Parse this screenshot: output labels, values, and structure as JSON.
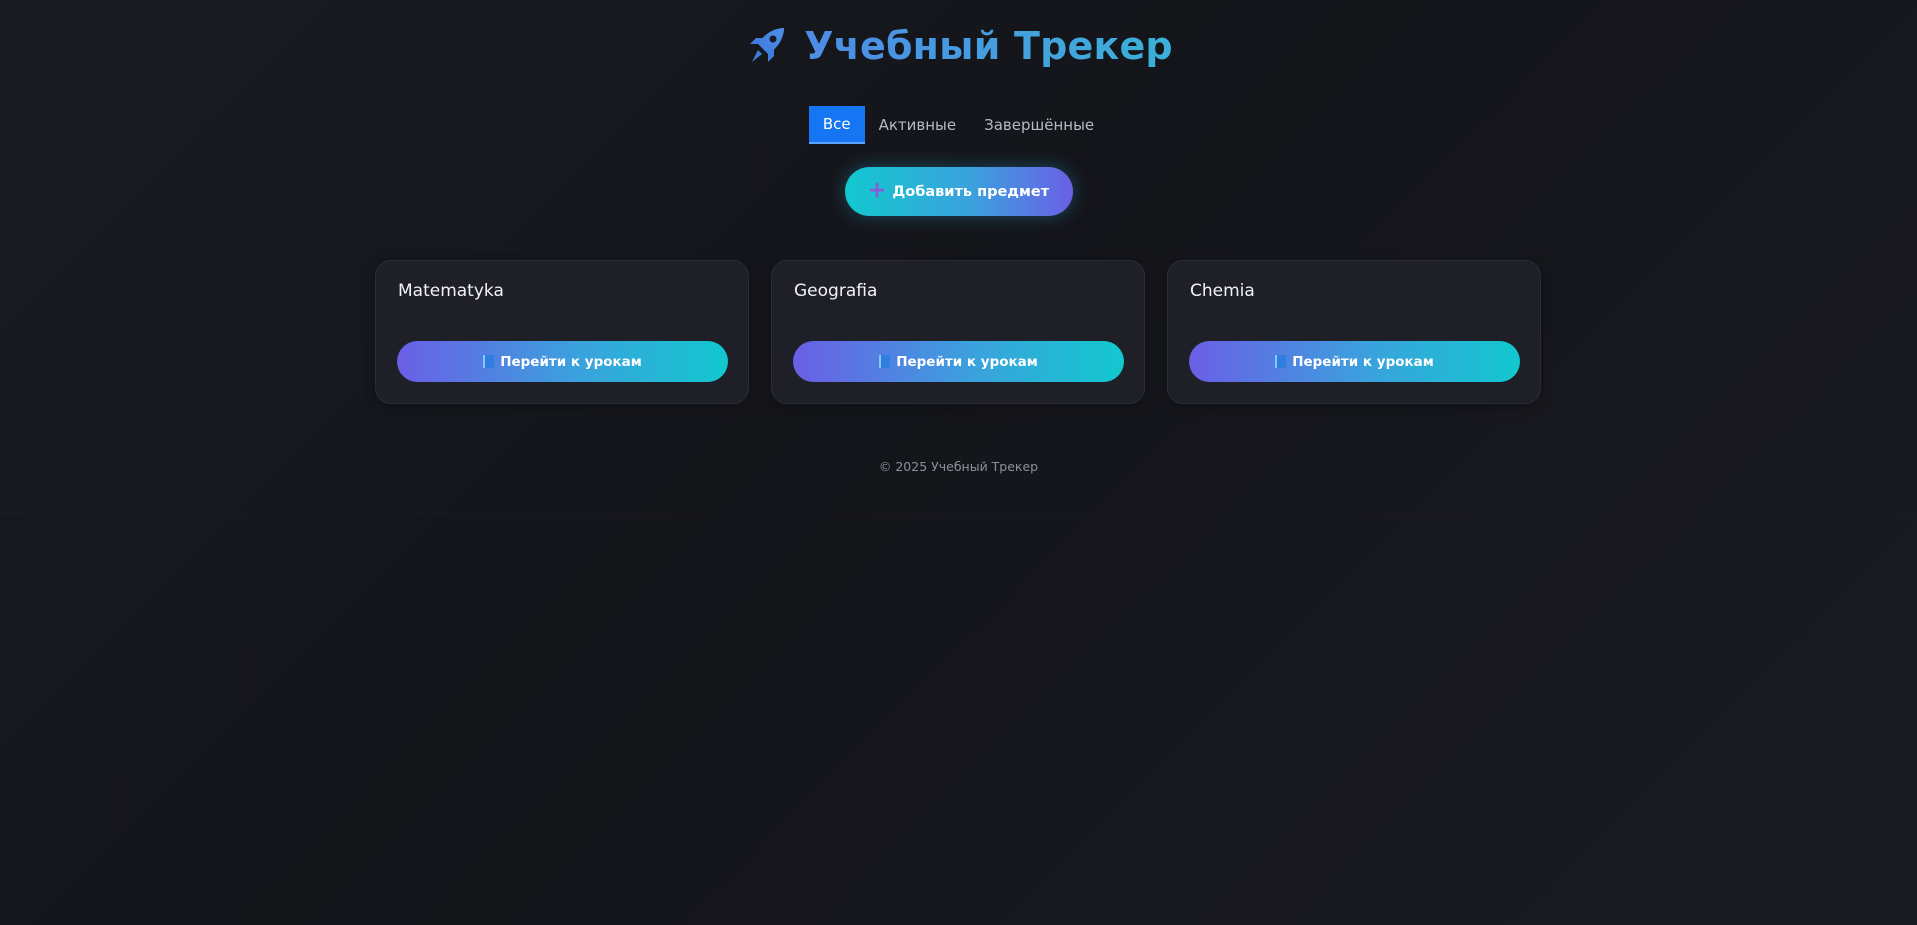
{
  "header": {
    "icon": "rocket-icon",
    "title": "Учебный Трекер"
  },
  "tabs": [
    {
      "label": "Все",
      "active": true
    },
    {
      "label": "Активные",
      "active": false
    },
    {
      "label": "Завершённые",
      "active": false
    }
  ],
  "add_button": {
    "icon": "plus-icon",
    "label": "Добавить предмет"
  },
  "cards": [
    {
      "title": "Matematyka",
      "button_label": "Перейти к урокам",
      "button_icon": "book-icon"
    },
    {
      "title": "Geografia",
      "button_label": "Перейти к урокам",
      "button_icon": "book-icon"
    },
    {
      "title": "Chemia",
      "button_label": "Перейти к урокам",
      "button_icon": "book-icon"
    }
  ],
  "footer": {
    "text": "© 2025 Учебный Трекер"
  },
  "colors": {
    "background": "#16171d",
    "active_tab": "#1675f2",
    "accent_cyan": "#12c8cf",
    "accent_violet": "#6a5fe6",
    "title_blue": "#4f8be6"
  }
}
